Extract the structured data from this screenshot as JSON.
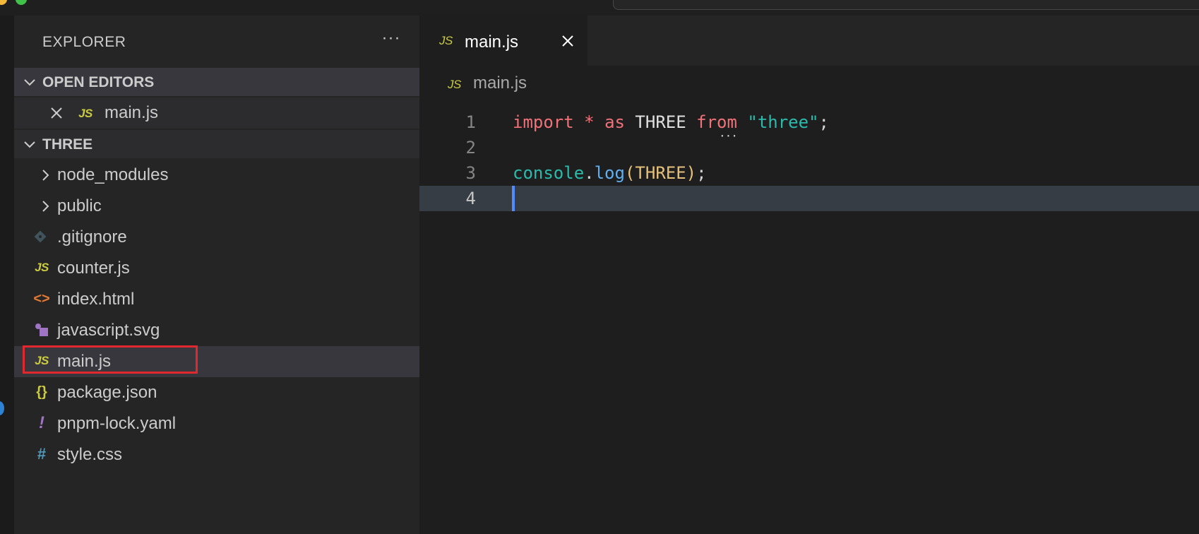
{
  "explorer": {
    "title": "EXPLORER",
    "more_label": "···"
  },
  "open_editors": {
    "header": "OPEN EDITORS",
    "items": [
      {
        "icon": "js-file-icon",
        "label": "main.js",
        "icon_text": "JS"
      }
    ]
  },
  "project": {
    "header": "THREE",
    "folders": [
      {
        "label": "node_modules"
      },
      {
        "label": "public"
      }
    ],
    "files": [
      {
        "icon": "git-file-icon",
        "label": ".gitignore"
      },
      {
        "icon": "js-file-icon",
        "label": "counter.js",
        "icon_text": "JS"
      },
      {
        "icon": "html-file-icon",
        "label": "index.html",
        "icon_text": "<>"
      },
      {
        "icon": "svg-file-icon",
        "label": "javascript.svg"
      },
      {
        "icon": "js-file-icon",
        "label": "main.js",
        "icon_text": "JS",
        "selected": true
      },
      {
        "icon": "json-file-icon",
        "label": "package.json",
        "icon_text": "{}"
      },
      {
        "icon": "yaml-file-icon",
        "label": "pnpm-lock.yaml",
        "icon_text": "!"
      },
      {
        "icon": "css-file-icon",
        "label": "style.css",
        "icon_text": "#"
      }
    ]
  },
  "editor": {
    "tab": {
      "label": "main.js",
      "icon_text": "JS"
    },
    "breadcrumb": {
      "label": "main.js",
      "icon_text": "JS"
    },
    "lines": [
      {
        "num": "1",
        "tokens": [
          "import",
          " ",
          "*",
          " ",
          "as",
          " ",
          "THREE",
          " ",
          "from",
          " ",
          "\"three\"",
          ";"
        ]
      },
      {
        "num": "2",
        "tokens": []
      },
      {
        "num": "3",
        "tokens": [
          "console",
          ".",
          "log",
          "(",
          "THREE",
          ")",
          ";"
        ]
      },
      {
        "num": "4",
        "tokens": []
      }
    ],
    "current_line": 4
  },
  "colors": {
    "accent_highlight": "#e0282e",
    "js_icon": "#cbcb41",
    "cursor": "#528bff"
  }
}
